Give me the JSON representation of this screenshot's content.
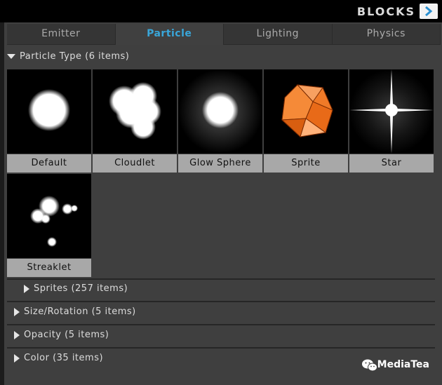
{
  "header": {
    "title": "BLOCKS",
    "arrow_icon": "chevron-right-icon"
  },
  "tabs": [
    {
      "label": "Emitter"
    },
    {
      "label": "Particle"
    },
    {
      "label": "Lighting"
    },
    {
      "label": "Physics"
    }
  ],
  "active_tab": "Particle",
  "sections": {
    "particle_type": {
      "label": "Particle Type  (6 items)",
      "expanded": true
    },
    "sprites": {
      "label": "Sprites  (257 items)",
      "expanded": false
    },
    "size_rotation": {
      "label": "Size/Rotation  (5 items)",
      "expanded": false
    },
    "opacity": {
      "label": "Opacity  (5 items)",
      "expanded": false
    },
    "color": {
      "label": "Color  (35 items)",
      "expanded": false
    }
  },
  "particle_types": [
    {
      "label": "Default"
    },
    {
      "label": "Cloudlet"
    },
    {
      "label": "Glow Sphere"
    },
    {
      "label": "Sprite"
    },
    {
      "label": "Star"
    },
    {
      "label": "Streaklet"
    }
  ],
  "colors": {
    "accent": "#39a6d9",
    "sprite_orange": "#f07a28",
    "panel": "#3f3f3f"
  },
  "watermark": {
    "text": "MediaTea",
    "icon": "wechat-icon"
  }
}
